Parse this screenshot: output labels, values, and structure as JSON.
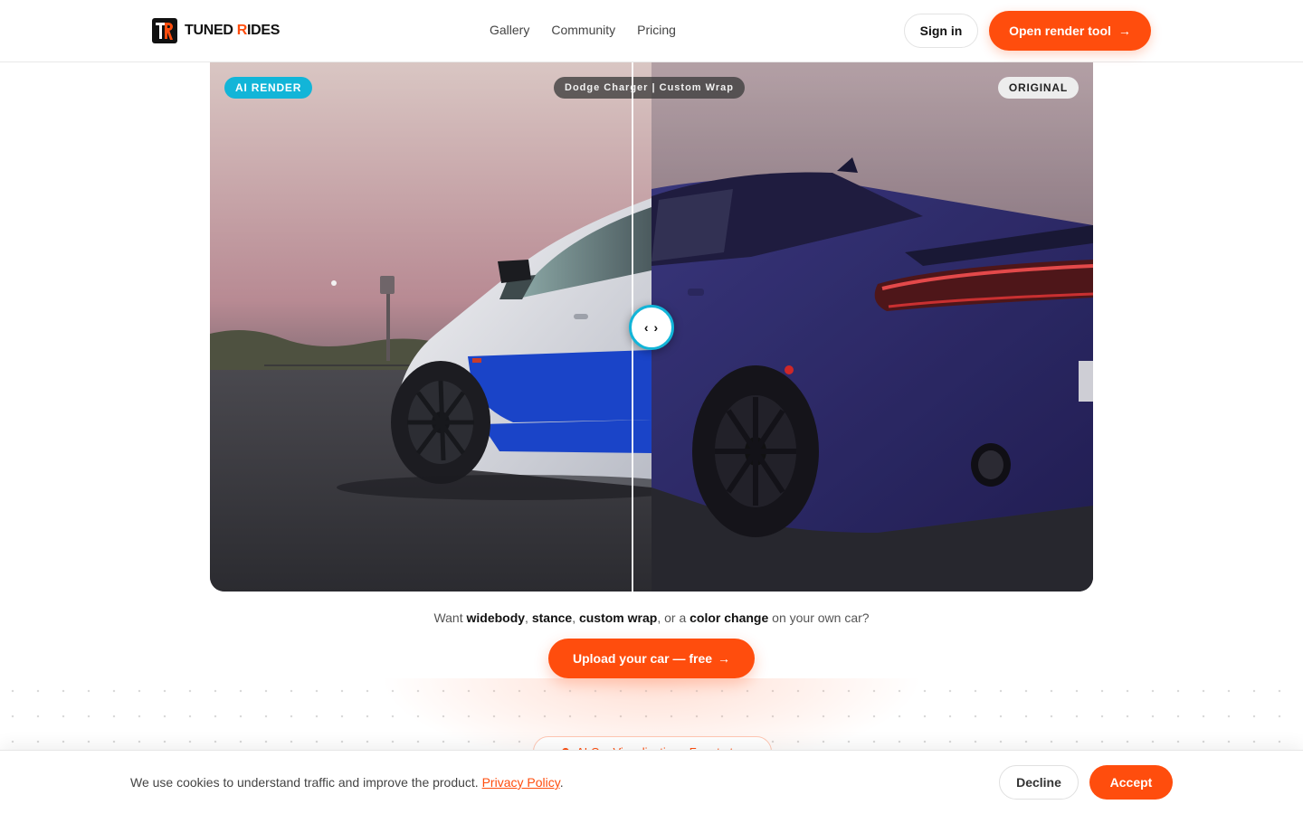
{
  "brand": {
    "name_prefix": "TUNED ",
    "name_accent": "R",
    "name_suffix": "IDES",
    "logo_icon": "tr-logo-icon",
    "accent_color": "#ff4d0d"
  },
  "nav": {
    "items": [
      {
        "label": "Gallery"
      },
      {
        "label": "Community"
      },
      {
        "label": "Pricing"
      }
    ]
  },
  "header": {
    "signin_label": "Sign in",
    "cta_label": "Open render tool",
    "cta_icon": "arrow-right-icon"
  },
  "viewer": {
    "render_badge": "AI RENDER",
    "title_badge": "Dodge Charger | Custom Wrap",
    "original_badge": "ORIGINAL",
    "handle_icon": "compare-arrows-icon",
    "handle_glyph": "‹ ›",
    "split_position": 0.5,
    "render_accent": "#12b5d8"
  },
  "prompt": {
    "prefix": "Want ",
    "word1": "widebody",
    "sep1": ", ",
    "word2": "stance",
    "sep2": ", ",
    "word3": "custom wrap",
    "sep3": ", or a ",
    "word4": "color change",
    "suffix": " on your own car?"
  },
  "upload": {
    "label": "Upload your car — free",
    "icon": "arrow-right-icon"
  },
  "hero_pill": {
    "label": "AI Car Visualization · Free to try"
  },
  "cookie": {
    "text": "We use cookies to understand traffic and improve the product. ",
    "link_label": "Privacy Policy",
    "end": ".",
    "decline_label": "Decline",
    "accept_label": "Accept"
  }
}
